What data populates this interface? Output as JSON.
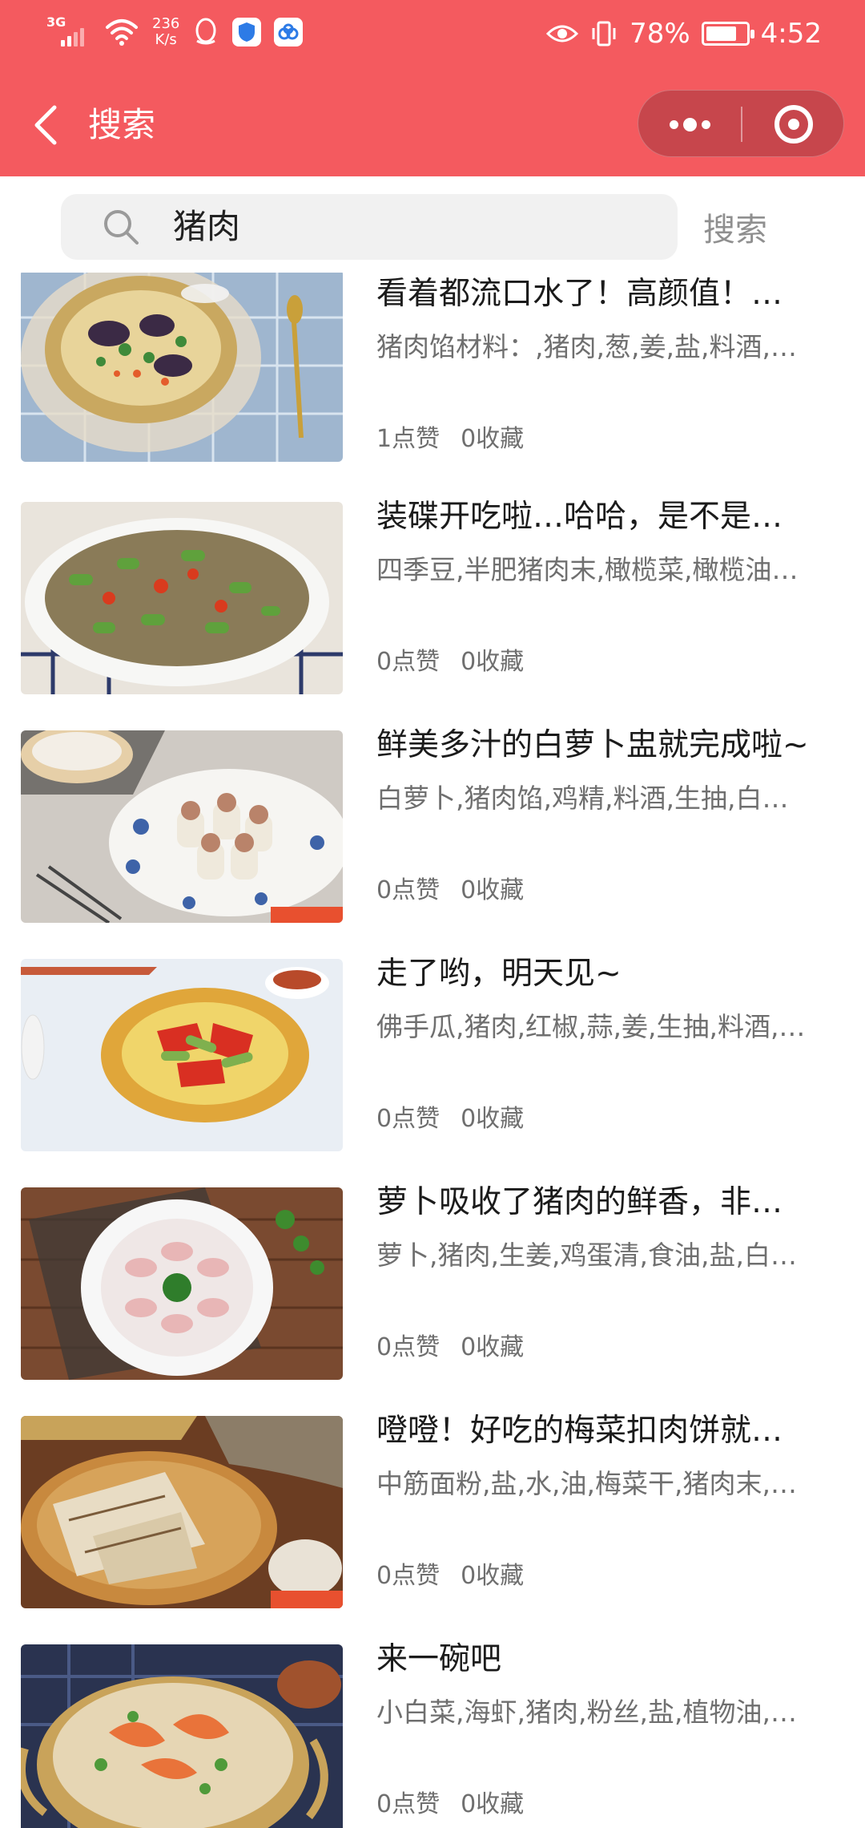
{
  "status_bar": {
    "network_type": "3G",
    "speed_value": "236",
    "speed_unit": "K/s",
    "battery": "78%",
    "battery_level": 0.78,
    "time": "4:52"
  },
  "navbar": {
    "title": "搜索",
    "accent": "#f45a5f"
  },
  "search": {
    "query": "猪肉",
    "button_label": "搜索"
  },
  "results": [
    {
      "title": "看着都流口水了！高颜值！…",
      "ingredients": "猪肉馅材料：,猪肉,葱,姜,盐,料酒,…",
      "likes": "1点赞",
      "favorites": "0收藏"
    },
    {
      "title": "装碟开吃啦…哈哈，是不是…",
      "ingredients": "四季豆,半肥猪肉末,橄榄菜,橄榄油…",
      "likes": "0点赞",
      "favorites": "0收藏"
    },
    {
      "title": "鲜美多汁的白萝卜盅就完成啦~",
      "ingredients": "白萝卜,猪肉馅,鸡精,料酒,生抽,白…",
      "likes": "0点赞",
      "favorites": "0收藏"
    },
    {
      "title": "走了哟，明天见~",
      "ingredients": "佛手瓜,猪肉,红椒,蒜,姜,生抽,料酒,…",
      "likes": "0点赞",
      "favorites": "0收藏"
    },
    {
      "title": "萝卜吸收了猪肉的鲜香，非…",
      "ingredients": "萝卜,猪肉,生姜,鸡蛋清,食油,盐,白…",
      "likes": "0点赞",
      "favorites": "0收藏"
    },
    {
      "title": "噔噔！好吃的梅菜扣肉饼就…",
      "ingredients": "中筋面粉,盐,水,油,梅菜干,猪肉末,…",
      "likes": "0点赞",
      "favorites": "0收藏"
    },
    {
      "title": "来一碗吧",
      "ingredients": "小白菜,海虾,猪肉,粉丝,盐,植物油,…",
      "likes": "0点赞",
      "favorites": "0收藏"
    }
  ]
}
